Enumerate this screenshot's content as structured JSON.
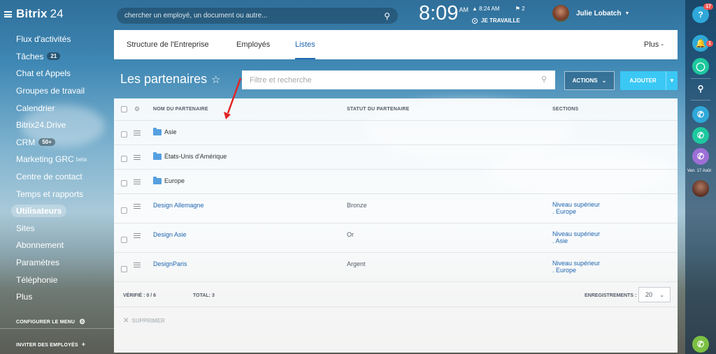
{
  "app": {
    "logo_main": "Bitrix",
    "logo_suffix": "24"
  },
  "sidebar": {
    "items": [
      {
        "label": "Flux d'activités"
      },
      {
        "label": "Tâches",
        "counter": "21"
      },
      {
        "label": "Chat et Appels"
      },
      {
        "label": "Groupes de travail"
      },
      {
        "label": "Calendrier"
      },
      {
        "label": "Bitrix24.Drive"
      },
      {
        "label": "CRM",
        "counter": "50+"
      },
      {
        "label": "Marketing GRC",
        "sup": "beta"
      },
      {
        "label": "Centre de contact"
      },
      {
        "label": "Temps et rapports"
      },
      {
        "label": "Utilisateurs",
        "active": true
      },
      {
        "label": "Sites"
      },
      {
        "label": "Abonnement"
      },
      {
        "label": "Paramètres"
      },
      {
        "label": "Téléphonie"
      },
      {
        "label": "Plus"
      }
    ],
    "configure_menu": "CONFIGURER LE MENU",
    "invite": "INVITER DES EMPLOYÉS"
  },
  "header": {
    "search_placeholder": "chercher un employé, un document ou autre...",
    "clock": "8:09",
    "clock_ampm": "AM",
    "start_time": "8:24 AM",
    "flag_count": "2",
    "work_status": "JE TRAVAILLE",
    "user_name": "Julie Lobatch"
  },
  "right_bar": {
    "help_badge": "17",
    "notif_badge": "1",
    "date": "Ven. 17 Août"
  },
  "tabs": [
    {
      "label": "Structure de l'Entreprise"
    },
    {
      "label": "Employés"
    },
    {
      "label": "Listes",
      "active": true
    }
  ],
  "tabs_more": "Plus -",
  "page": {
    "title": "Les partenaires",
    "filter_placeholder": "Filtre et recherche",
    "actions_label": "ACTIONS",
    "add_label": "AJOUTER"
  },
  "grid": {
    "columns": [
      "NOM DU PARTENAIRE",
      "STATUT DU PARTENAIRE",
      "SECTIONS"
    ],
    "rows": [
      {
        "name": "Asie",
        "type": "folder",
        "status": "",
        "sections": [
          "",
          ""
        ]
      },
      {
        "name": "États-Unis d'Amérique",
        "type": "folder",
        "status": "",
        "sections": [
          "",
          ""
        ]
      },
      {
        "name": "Europe",
        "type": "folder",
        "status": "",
        "sections": [
          "",
          ""
        ]
      },
      {
        "name": "Design Allemagne",
        "type": "item",
        "status": "Bronze",
        "sections": [
          "Niveau supérieur",
          ". Europe"
        ]
      },
      {
        "name": "Design Asie",
        "type": "item",
        "status": "Or",
        "sections": [
          "Niveau supérieur",
          ". Asie"
        ]
      },
      {
        "name": "DesignParis",
        "type": "item",
        "status": "Argent",
        "sections": [
          "Niveau supérieur",
          ". Europe"
        ]
      }
    ],
    "verified": "VÉRIFIÉ : 0 / 6",
    "total": "TOTAL: 3",
    "records_label": "ENREGISTREMENTS :",
    "records_value": "20",
    "delete_label": "SUPPRIMER"
  },
  "colors": {
    "accent": "#2067b0",
    "add_button": "#3bc8f5",
    "arrow": "#e02424"
  }
}
